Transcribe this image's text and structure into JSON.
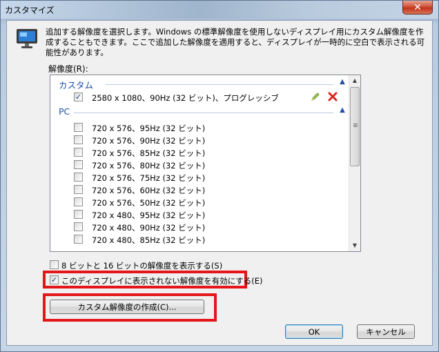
{
  "window": {
    "title": "カスタマイズ",
    "close_label": "✕"
  },
  "description": "追加する解像度を選択します。Windows の標準解像度を使用しないディスプレイ用にカスタム解像度を作成することもできます。ここで追加した解像度を適用すると、ディスプレイが一時的に空白で表示される可能性があります。",
  "resolutions_label": "解像度(R):",
  "groups": {
    "custom": {
      "title": "カスタム",
      "items": [
        {
          "label": "2580 x 1080、90Hz (32 ビット)、プログレッシブ",
          "checked": true
        }
      ]
    },
    "pc": {
      "title": "PC",
      "items": [
        {
          "label": "720 x 576、95Hz (32 ビット)",
          "checked": false
        },
        {
          "label": "720 x 576、90Hz (32 ビット)",
          "checked": false
        },
        {
          "label": "720 x 576、85Hz (32 ビット)",
          "checked": false
        },
        {
          "label": "720 x 576、80Hz (32 ビット)",
          "checked": false
        },
        {
          "label": "720 x 576、75Hz (32 ビット)",
          "checked": false
        },
        {
          "label": "720 x 576、60Hz (32 ビット)",
          "checked": false
        },
        {
          "label": "720 x 576、50Hz (32 ビット)",
          "checked": false
        },
        {
          "label": "720 x 480、95Hz (32 ビット)",
          "checked": false
        },
        {
          "label": "720 x 480、90Hz (32 ビット)",
          "checked": false
        },
        {
          "label": "720 x 480、85Hz (32 ビット)",
          "checked": false
        }
      ]
    }
  },
  "options": {
    "show_8_16_bit": {
      "label": "8 ビットと 16 ビットの解像度を表示する(S)",
      "checked": false
    },
    "enable_unsupported": {
      "label": "このディスプレイに表示されない解像度を有効にする(E)",
      "checked": true
    }
  },
  "buttons": {
    "create_custom": "カスタム解像度の作成(C)...",
    "ok": "OK",
    "cancel": "キャンセル"
  },
  "colors": {
    "highlight_border": "#e4161a",
    "group_title": "#1e4fa8",
    "delete_icon": "#d9261c",
    "edit_icon": "#8cb83a"
  },
  "icons": {
    "monitor": "monitor-icon",
    "edit": "pencil-icon",
    "delete": "delete-x-icon",
    "collapse": "chevron-up-icon"
  }
}
